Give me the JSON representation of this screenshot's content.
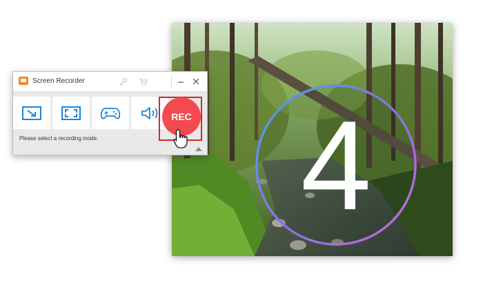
{
  "window": {
    "title": "Screen Recorder",
    "status": "Please select a recording mode.",
    "titlebar_icons": [
      "app-logo-icon",
      "key-icon",
      "cart-icon",
      "minimize-icon",
      "close-icon"
    ]
  },
  "modes": [
    {
      "name": "region-mode",
      "icon": "region-select-icon"
    },
    {
      "name": "fullscreen-mode",
      "icon": "fullscreen-icon"
    },
    {
      "name": "game-mode",
      "icon": "gamepad-icon"
    },
    {
      "name": "audio-mode",
      "icon": "speaker-icon"
    }
  ],
  "rec_button": {
    "label": "REC"
  },
  "countdown": {
    "digit": "4"
  },
  "colors": {
    "accent": "#1a86d9",
    "rec": "#f24a50",
    "highlight_frame": "#d8262c",
    "logo": "#f08a2c"
  }
}
